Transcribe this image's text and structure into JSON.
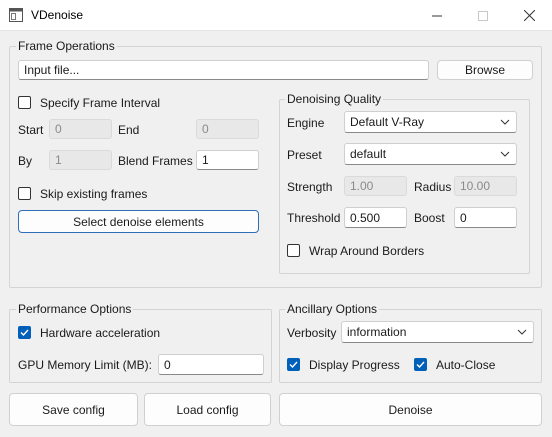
{
  "window": {
    "title": "VDenoise"
  },
  "frame_ops": {
    "title": "Frame Operations",
    "input_file_value": "Input file...",
    "browse_label": "Browse",
    "specify_interval_label": "Specify Frame Interval",
    "specify_interval_checked": false,
    "start_label": "Start",
    "start_value": "0",
    "end_label": "End",
    "end_value": "0",
    "by_label": "By",
    "by_value": "1",
    "blend_label": "Blend Frames",
    "blend_value": "1",
    "skip_label": "Skip existing frames",
    "skip_checked": false,
    "select_elements_label": "Select denoise elements"
  },
  "quality": {
    "title": "Denoising Quality",
    "engine_label": "Engine",
    "engine_value": "Default V-Ray",
    "preset_label": "Preset",
    "preset_value": "default",
    "strength_label": "Strength",
    "strength_value": "1.00",
    "radius_label": "Radius",
    "radius_value": "10.00",
    "threshold_label": "Threshold",
    "threshold_value": "0.500",
    "boost_label": "Boost",
    "boost_value": "0",
    "wrap_label": "Wrap Around Borders",
    "wrap_checked": false
  },
  "performance": {
    "title": "Performance Options",
    "hw_label": "Hardware acceleration",
    "hw_checked": true,
    "gpu_label": "GPU Memory Limit (MB):",
    "gpu_value": "0"
  },
  "ancillary": {
    "title": "Ancillary Options",
    "verbosity_label": "Verbosity",
    "verbosity_value": "information",
    "display_progress_label": "Display Progress",
    "display_progress_checked": true,
    "auto_close_label": "Auto-Close",
    "auto_close_checked": true
  },
  "buttons": {
    "save_config": "Save config",
    "load_config": "Load config",
    "denoise": "Denoise"
  },
  "colors": {
    "accent": "#005fb8",
    "default_border": "#2f6fb8"
  }
}
